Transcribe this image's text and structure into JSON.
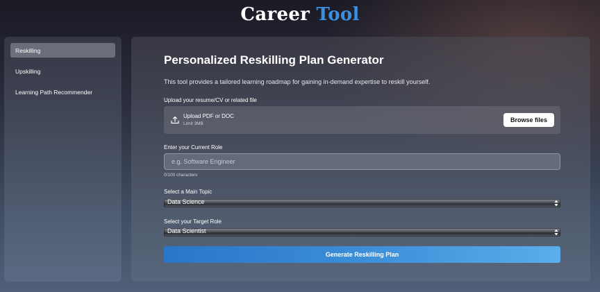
{
  "app": {
    "title_part1": "Career",
    "title_part2": "Tool"
  },
  "sidebar": {
    "items": [
      {
        "label": "Reskilling",
        "active": true
      },
      {
        "label": "Upskilling",
        "active": false
      },
      {
        "label": "Learning Path Recommender",
        "active": false
      }
    ]
  },
  "main": {
    "heading": "Personalized Reskilling Plan Generator",
    "description": "This tool provides a tailored learning roadmap for gaining in-demand expertise to reskill yourself.",
    "upload": {
      "label": "Upload your resume/CV or related file",
      "main_text": "Upload PDF or DOC",
      "limit_text": "Limit 3MB",
      "browse_label": "Browse files",
      "icon": "upload-icon"
    },
    "current_role": {
      "label": "Enter your Current Role",
      "value": "",
      "placeholder": "e.g. Software Engineer",
      "char_count": "0/100 characters"
    },
    "main_topic": {
      "label": "Select a Main Topic",
      "selected": "Data Science"
    },
    "target_role": {
      "label": "Select your Target Role",
      "selected": "Data Scientist"
    },
    "generate_label": "Generate Reskilling Plan"
  },
  "colors": {
    "accent": "#3b8fe0",
    "button_gradient_start": "#2a75c8",
    "button_gradient_end": "#5aaee9"
  }
}
